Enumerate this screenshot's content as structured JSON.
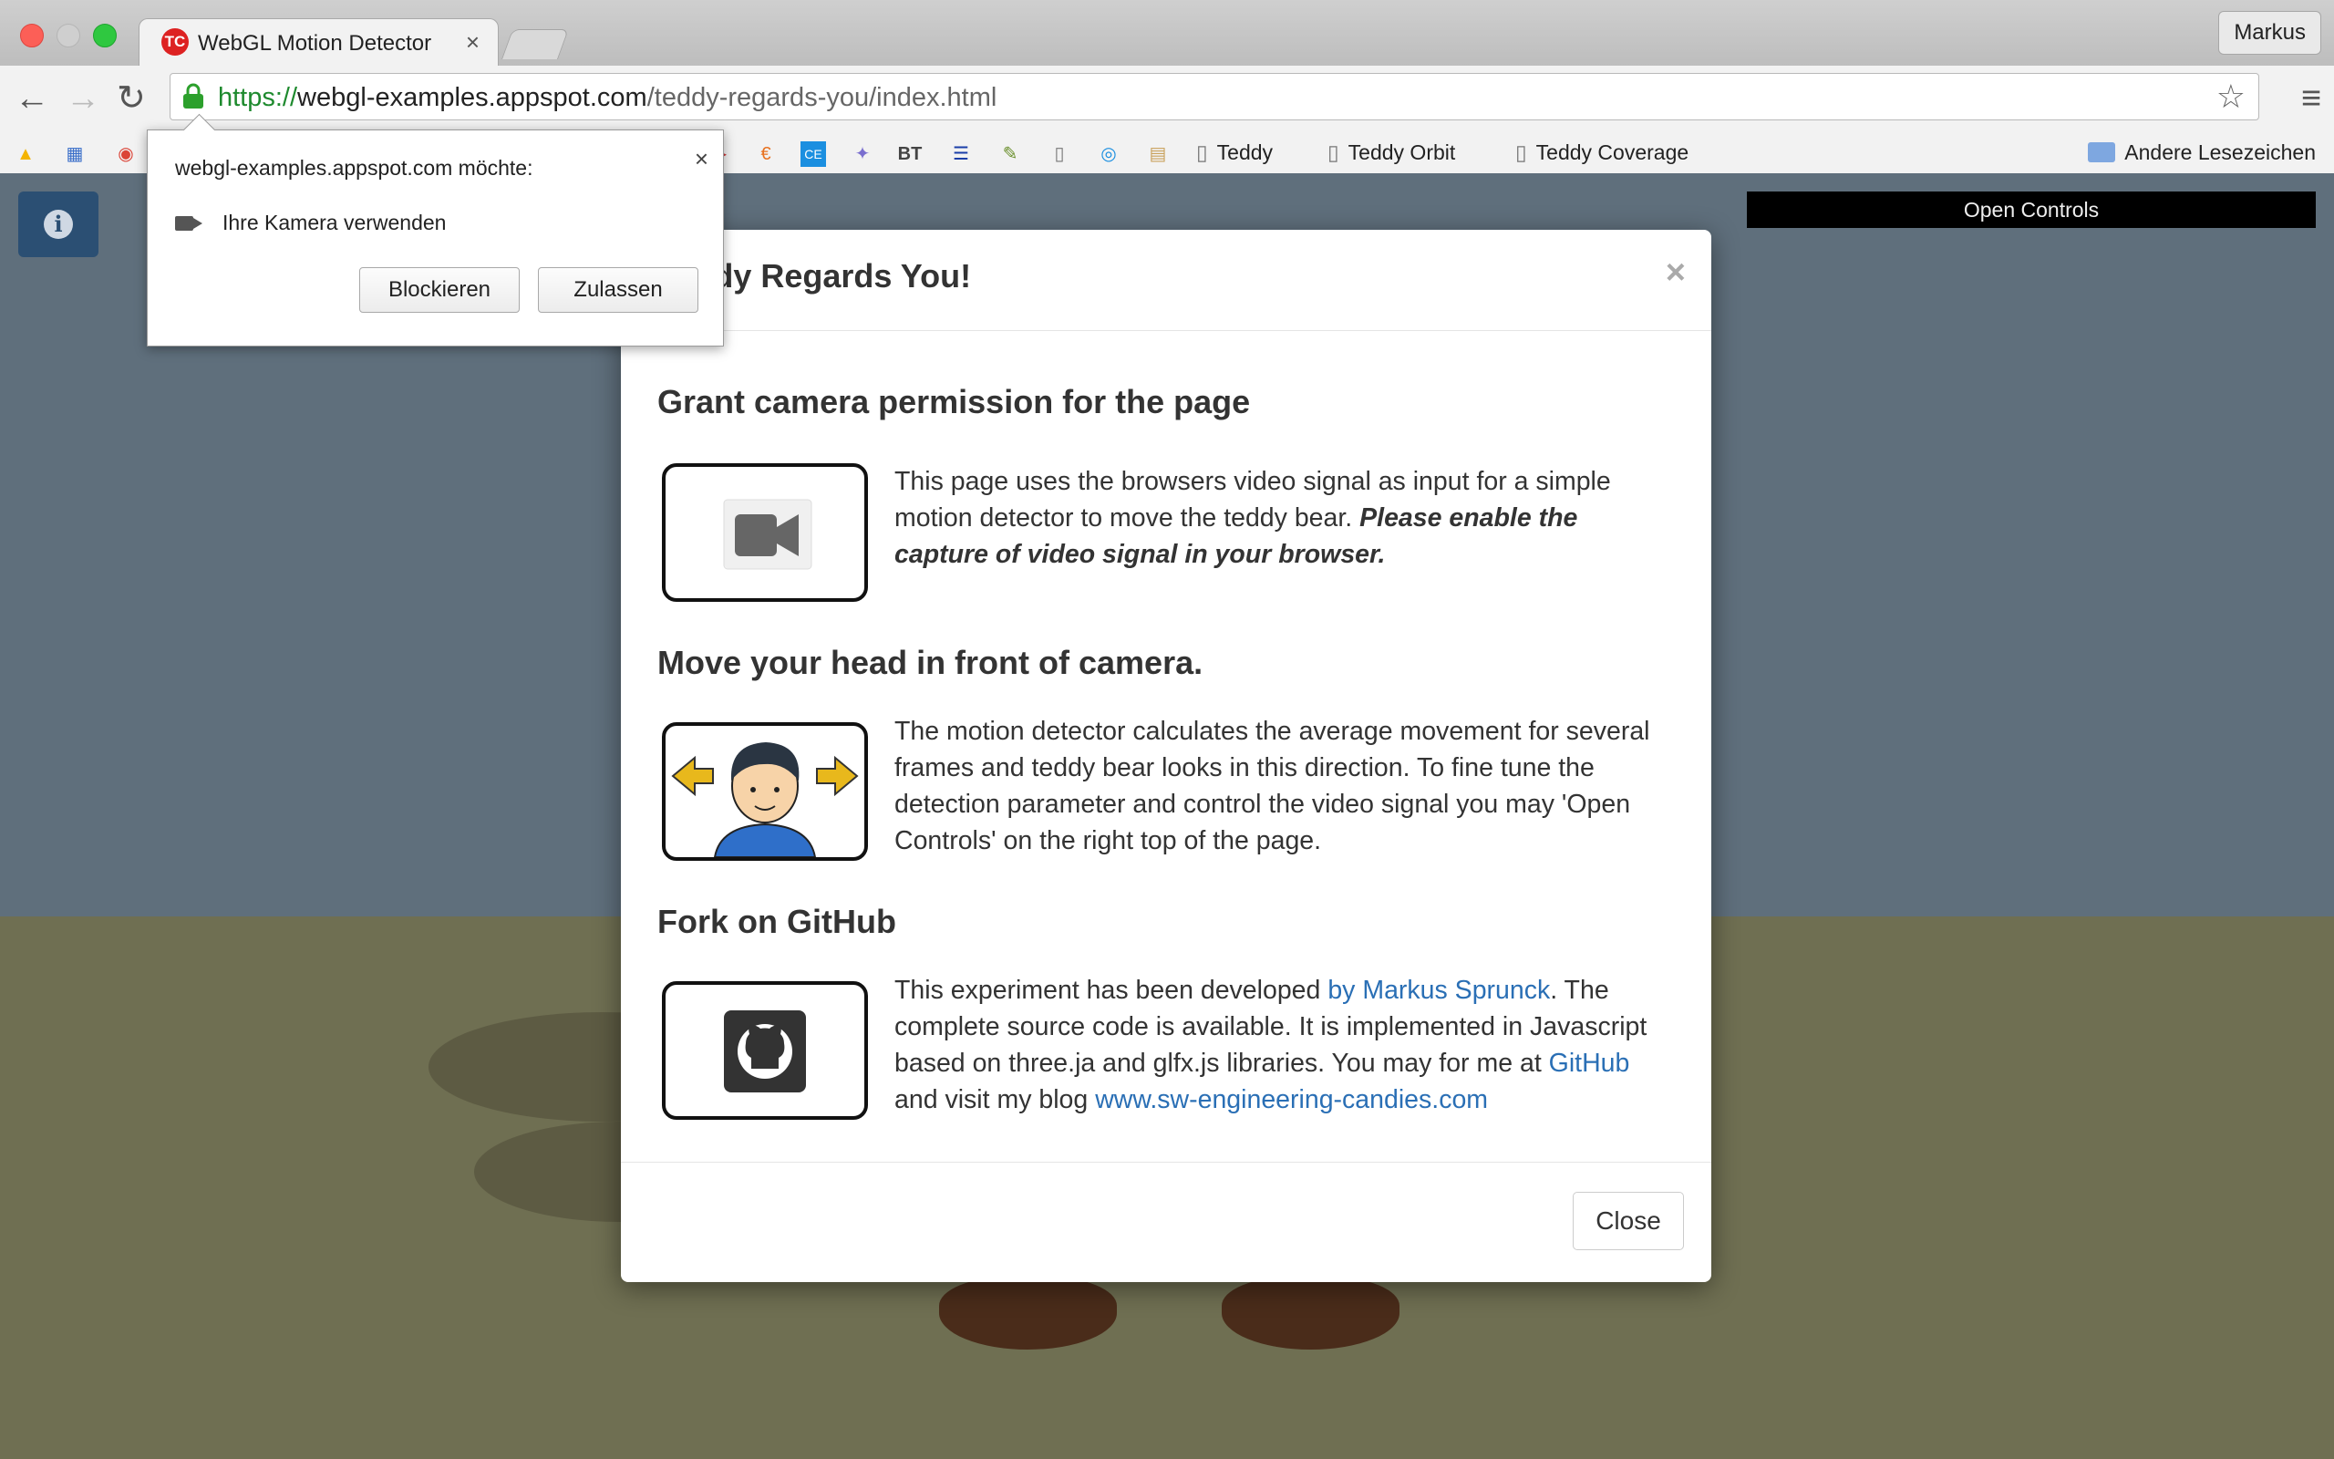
{
  "browser": {
    "tab_title": "WebGL Motion Detector",
    "tab_close": "×",
    "profile": "Markus",
    "url_scheme": "https://",
    "url_host": "webgl-examples.appspot.com",
    "url_path": "/teddy-regards-you/index.html",
    "bookmarks": [
      {
        "label": "Teddy"
      },
      {
        "label": "Teddy Orbit"
      },
      {
        "label": "Teddy Coverage"
      }
    ],
    "bookmarks_folder": "Andere Lesezeichen"
  },
  "permission_popup": {
    "title": "webgl-examples.appspot.com möchte:",
    "request": "Ihre Kamera verwenden",
    "block_label": "Blockieren",
    "allow_label": "Zulassen",
    "close": "×"
  },
  "page": {
    "open_controls": "Open Controls"
  },
  "modal": {
    "title": "Teddy Regards You!",
    "close_x": "×",
    "sections": [
      {
        "heading": "Grant camera permission for the page",
        "text": "This page uses the browsers video signal as input for a simple motion detector to move the teddy bear. ",
        "emphasis": "Please enable the capture of video signal in your browser."
      },
      {
        "heading": "Move your head in front of camera.",
        "text": "The motion detector calculates the average movement for several frames and teddy bear looks in this direction. To fine tune the detection parameter and control the video signal you may 'Open Controls' on the right top of the page."
      },
      {
        "heading": "Fork on GitHub",
        "text_1": "This experiment has been developed ",
        "link_author": "by Markus Sprunck",
        "text_2": ". The complete source code is available. It is implemented in Javascript based on three.ja and glfx.js libraries. You may for me at ",
        "link_github": "GitHub",
        "text_3": " and visit my blog ",
        "link_blog": "www.sw-engineering-candies.com"
      }
    ],
    "close_button": "Close"
  }
}
